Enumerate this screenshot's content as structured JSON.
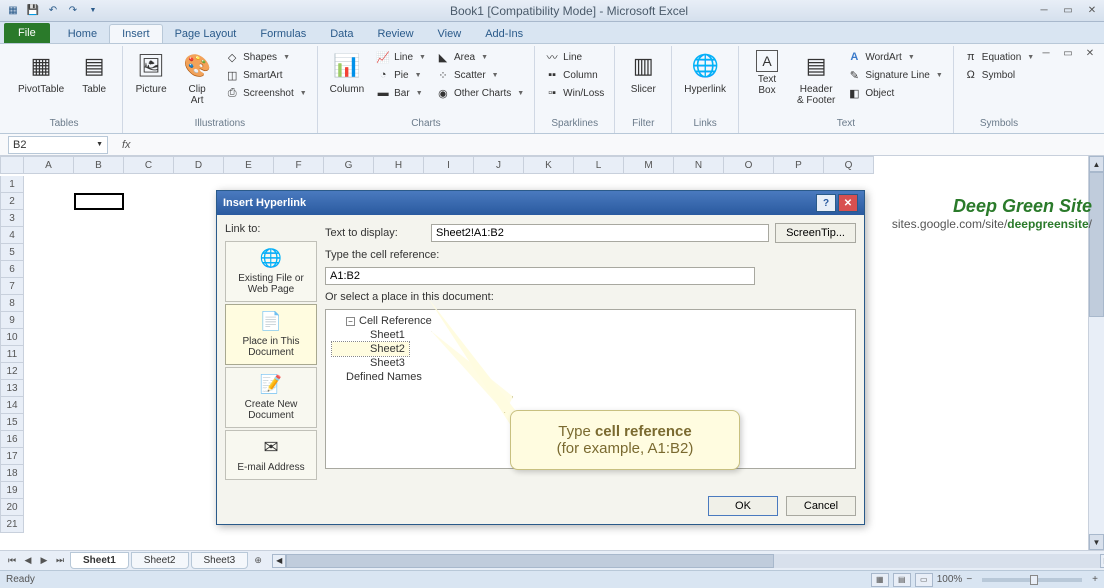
{
  "app": {
    "title": "Book1  [Compatibility Mode]  -  Microsoft Excel"
  },
  "tabs": {
    "file": "File",
    "items": [
      "Home",
      "Insert",
      "Page Layout",
      "Formulas",
      "Data",
      "Review",
      "View",
      "Add-Ins"
    ],
    "active": "Insert"
  },
  "ribbon": {
    "groups": {
      "tables": {
        "label": "Tables",
        "pivot": "PivotTable",
        "table": "Table"
      },
      "illustrations": {
        "label": "Illustrations",
        "picture": "Picture",
        "clipart": "Clip\nArt",
        "shapes": "Shapes",
        "smartart": "SmartArt",
        "screenshot": "Screenshot"
      },
      "charts": {
        "label": "Charts",
        "column": "Column",
        "line": "Line",
        "pie": "Pie",
        "bar": "Bar",
        "area": "Area",
        "scatter": "Scatter",
        "other": "Other Charts"
      },
      "sparklines": {
        "label": "Sparklines",
        "line": "Line",
        "column": "Column",
        "winloss": "Win/Loss"
      },
      "filter": {
        "label": "Filter",
        "slicer": "Slicer"
      },
      "links": {
        "label": "Links",
        "hyperlink": "Hyperlink"
      },
      "text": {
        "label": "Text",
        "textbox": "Text\nBox",
        "headerfooter": "Header\n& Footer",
        "wordart": "WordArt",
        "sigline": "Signature Line",
        "object": "Object"
      },
      "symbols": {
        "label": "Symbols",
        "equation": "Equation",
        "symbol": "Symbol"
      }
    }
  },
  "formulabar": {
    "namebox": "B2",
    "fx": "fx",
    "formula": ""
  },
  "columns": [
    "A",
    "B",
    "C",
    "D",
    "E",
    "F",
    "G",
    "H",
    "I",
    "J",
    "K",
    "L",
    "M",
    "N",
    "O",
    "P",
    "Q"
  ],
  "rows": 21,
  "dialog": {
    "title": "Insert Hyperlink",
    "linkto": "Link to:",
    "sidebtns": {
      "existing": "Existing File or Web Page",
      "place": "Place in This Document",
      "createnew": "Create New Document",
      "email": "E-mail Address"
    },
    "text_to_display_label": "Text to display:",
    "text_to_display_value": "Sheet2!A1:B2",
    "screentip": "ScreenTip...",
    "type_ref_label": "Type the cell reference:",
    "type_ref_value": "A1:B2",
    "select_place_label": "Or select a place in this document:",
    "tree": {
      "cellref": "Cell Reference",
      "sheets": [
        "Sheet1",
        "Sheet2",
        "Sheet3"
      ],
      "selected": "Sheet2",
      "defnames": "Defined Names"
    },
    "ok": "OK",
    "cancel": "Cancel"
  },
  "callout": {
    "line1": "Type ",
    "bold": "cell reference",
    "line2": "(for example, A1:B2)"
  },
  "watermark": {
    "title": "Deep Green Site",
    "url_pre": "sites.google.com/site/",
    "url_bold": "deepgreensite",
    "url_post": "/"
  },
  "sheets": {
    "tabs": [
      "Sheet1",
      "Sheet2",
      "Sheet3"
    ],
    "active": "Sheet1"
  },
  "status": {
    "ready": "Ready",
    "zoom": "100%"
  }
}
